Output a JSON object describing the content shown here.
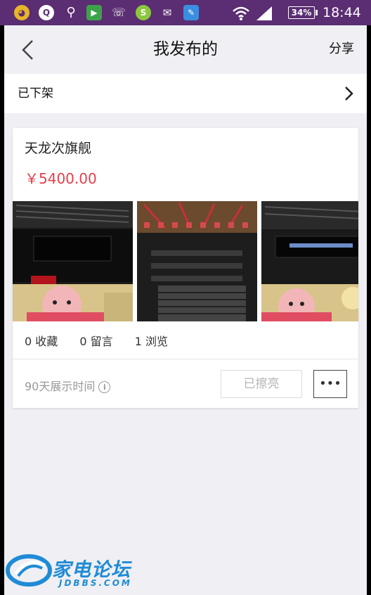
{
  "status_bar": {
    "battery": "34%",
    "time": "18:44"
  },
  "nav": {
    "title": "我发布的",
    "share": "分享"
  },
  "section": {
    "label": "已下架"
  },
  "listing": {
    "title": "天龙次旗舰",
    "price": "￥5400.00",
    "stats": {
      "favorites": "0 收藏",
      "comments": "0 留言",
      "views": "1 浏览"
    },
    "show_time": "90天展示时间",
    "polished_button": "已擦亮",
    "more_button": "•••"
  },
  "watermark": {
    "name": "家电论坛",
    "domain": "JDBBS.COM"
  },
  "colors": {
    "status_bar": "#5b2d72",
    "price": "#e5404a",
    "watermark": "#1f8bd6"
  }
}
